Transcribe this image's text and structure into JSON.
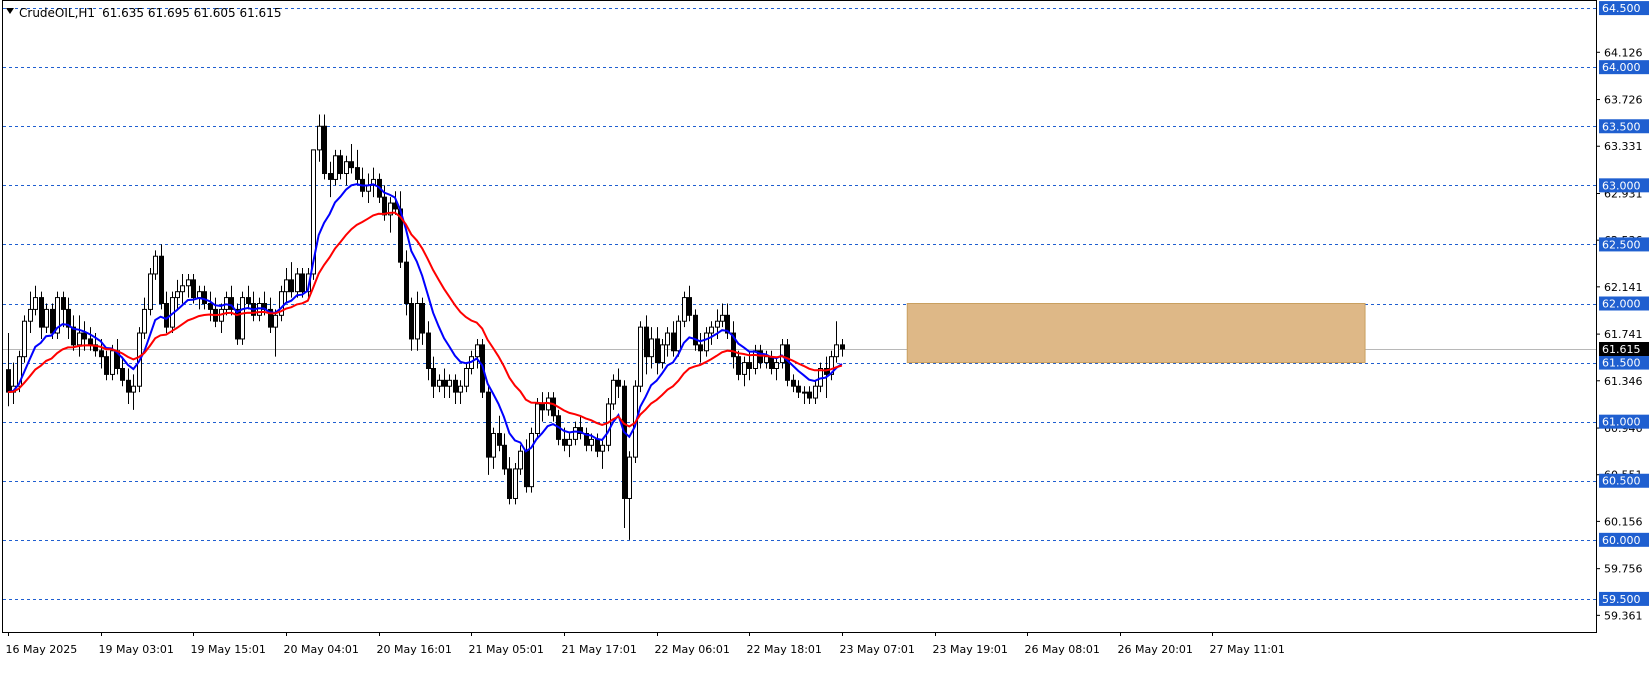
{
  "header": {
    "symbol_label": "CrudeOIL,H1",
    "ohlc_label": "61.635 61.695 61.605 61.615"
  },
  "colors": {
    "background": "#ffffff",
    "frame": "#000000",
    "grid_dashed": "#1f5fd0",
    "price_box_fill": "#1f5fd0",
    "current_price_fill": "#000000",
    "ma_fast": "#0000ff",
    "ma_slow": "#ff0000",
    "zone_fill": "#deb887",
    "zone_stroke": "#c9a060",
    "candle_up_fill": "#ffffff",
    "candle_down_fill": "#000000",
    "candle_stroke": "#000000"
  },
  "chart_data": {
    "type": "candlestick",
    "symbol": "CrudeOIL",
    "timeframe": "H1",
    "ylim": [
      59.22,
      64.56
    ],
    "current_price": 61.615,
    "current_price_label": "61.615",
    "axis_ticks": [
      {
        "value": 64.126,
        "label": "64.126"
      },
      {
        "value": 63.726,
        "label": "63.726"
      },
      {
        "value": 63.331,
        "label": "63.331"
      },
      {
        "value": 62.931,
        "label": "62.931"
      },
      {
        "value": 62.536,
        "label": "62.536"
      },
      {
        "value": 62.141,
        "label": "62.141"
      },
      {
        "value": 61.741,
        "label": "61.741"
      },
      {
        "value": 61.346,
        "label": "61.346"
      },
      {
        "value": 60.946,
        "label": "60.946"
      },
      {
        "value": 60.551,
        "label": "60.551"
      },
      {
        "value": 60.156,
        "label": "60.156"
      },
      {
        "value": 59.756,
        "label": "59.756"
      },
      {
        "value": 59.361,
        "label": "59.361"
      }
    ],
    "levels": [
      {
        "value": 64.5,
        "label": "64.500"
      },
      {
        "value": 64.0,
        "label": "64.000"
      },
      {
        "value": 63.5,
        "label": "63.500"
      },
      {
        "value": 63.0,
        "label": "63.000"
      },
      {
        "value": 62.5,
        "label": "62.500"
      },
      {
        "value": 62.0,
        "label": "62.000"
      },
      {
        "value": 61.5,
        "label": "61.500"
      },
      {
        "value": 61.0,
        "label": "61.000"
      },
      {
        "value": 60.5,
        "label": "60.500"
      },
      {
        "value": 60.0,
        "label": "60.000"
      },
      {
        "value": 59.5,
        "label": "59.500"
      }
    ],
    "zone": {
      "from_bar": 165,
      "to_bar": 249,
      "low": 61.5,
      "high": 62.0
    },
    "x_labels": [
      {
        "bar": 0,
        "label": "16 May 2025"
      },
      {
        "bar": 17,
        "label": "19 May 03:01"
      },
      {
        "bar": 34,
        "label": "19 May 15:01"
      },
      {
        "bar": 51,
        "label": "20 May 04:01"
      },
      {
        "bar": 68,
        "label": "20 May 16:01"
      },
      {
        "bar": 85,
        "label": "21 May 05:01"
      },
      {
        "bar": 102,
        "label": "21 May 17:01"
      },
      {
        "bar": 119,
        "label": "22 May 06:01"
      },
      {
        "bar": 136,
        "label": "22 May 18:01"
      },
      {
        "bar": 153,
        "label": "23 May 07:01"
      },
      {
        "bar": 170,
        "label": "23 May 19:01"
      },
      {
        "bar": 187,
        "label": "26 May 08:01"
      },
      {
        "bar": 204,
        "label": "26 May 20:01"
      },
      {
        "bar": 221,
        "label": "27 May 11:01"
      }
    ],
    "ma_fast_period_color": "blue",
    "ma_slow_period_color": "red",
    "ohlc": [
      [
        61.44,
        61.75,
        61.13,
        61.25
      ],
      [
        61.25,
        61.5,
        61.15,
        61.3
      ],
      [
        61.3,
        61.6,
        61.25,
        61.55
      ],
      [
        61.55,
        61.9,
        61.5,
        61.85
      ],
      [
        61.85,
        62.1,
        61.75,
        61.95
      ],
      [
        61.95,
        62.15,
        61.9,
        62.05
      ],
      [
        62.05,
        62.1,
        61.7,
        61.8
      ],
      [
        61.8,
        62.0,
        61.75,
        61.95
      ],
      [
        61.95,
        62.0,
        61.7,
        61.75
      ],
      [
        61.75,
        62.1,
        61.7,
        62.05
      ],
      [
        62.05,
        62.1,
        61.8,
        61.95
      ],
      [
        61.95,
        62.05,
        61.7,
        61.8
      ],
      [
        61.8,
        61.9,
        61.6,
        61.65
      ],
      [
        61.65,
        61.9,
        61.55,
        61.75
      ],
      [
        61.75,
        61.85,
        61.6,
        61.7
      ],
      [
        61.7,
        61.8,
        61.6,
        61.65
      ],
      [
        61.65,
        61.75,
        61.55,
        61.6
      ],
      [
        61.6,
        61.7,
        61.45,
        61.55
      ],
      [
        61.55,
        61.6,
        61.35,
        61.4
      ],
      [
        61.4,
        61.65,
        61.35,
        61.6
      ],
      [
        61.6,
        61.7,
        61.4,
        61.45
      ],
      [
        61.45,
        61.55,
        61.3,
        61.35
      ],
      [
        61.35,
        61.45,
        61.15,
        61.25
      ],
      [
        61.25,
        61.4,
        61.1,
        61.3
      ],
      [
        61.3,
        61.8,
        61.25,
        61.75
      ],
      [
        61.75,
        62.05,
        61.7,
        61.95
      ],
      [
        61.95,
        62.3,
        61.9,
        62.25
      ],
      [
        62.25,
        62.45,
        62.2,
        62.4
      ],
      [
        62.4,
        62.5,
        61.95,
        62.0
      ],
      [
        62.0,
        62.1,
        61.75,
        61.8
      ],
      [
        61.8,
        62.1,
        61.75,
        62.05
      ],
      [
        62.05,
        62.2,
        61.95,
        62.1
      ],
      [
        62.1,
        62.25,
        62.0,
        62.15
      ],
      [
        62.15,
        62.25,
        62.05,
        62.2
      ],
      [
        62.2,
        62.25,
        62.0,
        62.05
      ],
      [
        62.05,
        62.15,
        61.95,
        62.1
      ],
      [
        62.1,
        62.15,
        61.95,
        62.0
      ],
      [
        62.0,
        62.1,
        61.85,
        61.95
      ],
      [
        61.95,
        62.05,
        61.8,
        61.85
      ],
      [
        61.85,
        62.0,
        61.75,
        61.95
      ],
      [
        61.95,
        62.1,
        61.9,
        62.05
      ],
      [
        62.05,
        62.15,
        61.9,
        61.95
      ],
      [
        61.95,
        62.0,
        61.65,
        61.7
      ],
      [
        61.7,
        62.1,
        61.65,
        62.05
      ],
      [
        62.05,
        62.15,
        61.95,
        62.0
      ],
      [
        62.0,
        62.1,
        61.85,
        61.9
      ],
      [
        61.9,
        62.05,
        61.85,
        62.0
      ],
      [
        62.0,
        62.1,
        61.9,
        61.95
      ],
      [
        61.95,
        62.05,
        61.75,
        61.8
      ],
      [
        61.8,
        61.95,
        61.55,
        61.9
      ],
      [
        61.9,
        62.15,
        61.85,
        62.1
      ],
      [
        62.1,
        62.3,
        62.0,
        62.2
      ],
      [
        62.2,
        62.35,
        62.05,
        62.1
      ],
      [
        62.1,
        62.3,
        62.05,
        62.25
      ],
      [
        62.25,
        62.3,
        62.05,
        62.1
      ],
      [
        62.1,
        62.3,
        62.05,
        62.25
      ],
      [
        62.25,
        63.3,
        62.2,
        63.3
      ],
      [
        63.3,
        63.6,
        63.2,
        63.5
      ],
      [
        63.5,
        63.6,
        63.05,
        63.1
      ],
      [
        63.1,
        63.2,
        62.9,
        63.05
      ],
      [
        63.05,
        63.3,
        63.0,
        63.25
      ],
      [
        63.25,
        63.3,
        63.05,
        63.1
      ],
      [
        63.1,
        63.25,
        63.0,
        63.2
      ],
      [
        63.2,
        63.35,
        63.1,
        63.15
      ],
      [
        63.15,
        63.3,
        63.0,
        63.05
      ],
      [
        63.05,
        63.15,
        62.9,
        62.95
      ],
      [
        62.95,
        63.1,
        62.85,
        63.0
      ],
      [
        63.0,
        63.15,
        62.9,
        63.05
      ],
      [
        63.05,
        63.1,
        62.85,
        62.9
      ],
      [
        62.9,
        63.0,
        62.7,
        62.75
      ],
      [
        62.75,
        62.9,
        62.6,
        62.85
      ],
      [
        62.85,
        62.95,
        62.75,
        62.8
      ],
      [
        62.8,
        62.95,
        62.3,
        62.35
      ],
      [
        62.35,
        62.45,
        61.9,
        62.0
      ],
      [
        62.0,
        62.05,
        61.6,
        61.7
      ],
      [
        61.7,
        62.1,
        61.6,
        62.0
      ],
      [
        62.0,
        62.05,
        61.65,
        61.75
      ],
      [
        61.75,
        61.85,
        61.35,
        61.45
      ],
      [
        61.45,
        61.55,
        61.2,
        61.3
      ],
      [
        61.3,
        61.4,
        61.25,
        61.35
      ],
      [
        61.35,
        61.45,
        61.2,
        61.3
      ],
      [
        61.3,
        61.4,
        61.2,
        61.35
      ],
      [
        61.35,
        61.4,
        61.15,
        61.25
      ],
      [
        61.25,
        61.35,
        61.15,
        61.3
      ],
      [
        61.3,
        61.5,
        61.25,
        61.45
      ],
      [
        61.45,
        61.6,
        61.4,
        61.55
      ],
      [
        61.55,
        61.7,
        61.45,
        61.65
      ],
      [
        61.65,
        61.7,
        61.2,
        61.25
      ],
      [
        61.25,
        61.3,
        60.55,
        60.7
      ],
      [
        60.7,
        60.95,
        60.6,
        60.9
      ],
      [
        60.9,
        61.05,
        60.75,
        60.8
      ],
      [
        60.8,
        60.9,
        60.55,
        60.6
      ],
      [
        60.6,
        60.7,
        60.3,
        60.35
      ],
      [
        60.35,
        60.65,
        60.3,
        60.6
      ],
      [
        60.6,
        60.8,
        60.55,
        60.75
      ],
      [
        60.75,
        60.85,
        60.4,
        60.45
      ],
      [
        60.45,
        60.95,
        60.4,
        60.9
      ],
      [
        60.9,
        61.2,
        60.85,
        61.15
      ],
      [
        61.15,
        61.25,
        61.0,
        61.1
      ],
      [
        61.1,
        61.25,
        61.05,
        61.2
      ],
      [
        61.2,
        61.25,
        61.0,
        61.05
      ],
      [
        61.05,
        61.1,
        60.8,
        60.85
      ],
      [
        60.85,
        60.95,
        60.75,
        60.8
      ],
      [
        60.8,
        60.9,
        60.7,
        60.85
      ],
      [
        60.85,
        61.0,
        60.8,
        60.95
      ],
      [
        60.95,
        61.05,
        60.85,
        60.9
      ],
      [
        60.9,
        60.95,
        60.75,
        60.8
      ],
      [
        60.8,
        60.9,
        60.75,
        60.85
      ],
      [
        60.85,
        60.9,
        60.7,
        60.75
      ],
      [
        60.75,
        60.85,
        60.6,
        60.8
      ],
      [
        60.8,
        61.2,
        60.75,
        61.15
      ],
      [
        61.15,
        61.4,
        61.1,
        61.35
      ],
      [
        61.35,
        61.45,
        61.2,
        61.3
      ],
      [
        61.3,
        61.35,
        60.1,
        60.35
      ],
      [
        60.35,
        60.75,
        60.0,
        60.7
      ],
      [
        60.7,
        61.35,
        60.65,
        61.3
      ],
      [
        61.3,
        61.85,
        61.25,
        61.8
      ],
      [
        61.8,
        61.9,
        61.4,
        61.55
      ],
      [
        61.55,
        61.8,
        61.45,
        61.7
      ],
      [
        61.7,
        61.8,
        61.4,
        61.5
      ],
      [
        61.5,
        61.7,
        61.45,
        61.65
      ],
      [
        61.65,
        61.8,
        61.55,
        61.75
      ],
      [
        61.75,
        61.85,
        61.55,
        61.6
      ],
      [
        61.6,
        61.9,
        61.55,
        61.85
      ],
      [
        61.85,
        62.1,
        61.8,
        62.05
      ],
      [
        62.05,
        62.15,
        61.85,
        61.9
      ],
      [
        61.9,
        61.95,
        61.6,
        61.65
      ],
      [
        61.65,
        61.75,
        61.5,
        61.6
      ],
      [
        61.6,
        61.8,
        61.55,
        61.75
      ],
      [
        61.75,
        61.85,
        61.65,
        61.8
      ],
      [
        61.8,
        61.95,
        61.7,
        61.85
      ],
      [
        61.85,
        62.0,
        61.8,
        61.9
      ],
      [
        61.9,
        62.0,
        61.7,
        61.75
      ],
      [
        61.75,
        61.85,
        61.45,
        61.55
      ],
      [
        61.55,
        61.6,
        61.35,
        61.4
      ],
      [
        61.4,
        61.55,
        61.3,
        61.5
      ],
      [
        61.5,
        61.6,
        61.35,
        61.45
      ],
      [
        61.45,
        61.65,
        61.4,
        61.6
      ],
      [
        61.6,
        61.65,
        61.45,
        61.5
      ],
      [
        61.5,
        61.6,
        61.45,
        61.55
      ],
      [
        61.55,
        61.6,
        61.4,
        61.45
      ],
      [
        61.45,
        61.55,
        61.35,
        61.5
      ],
      [
        61.5,
        61.7,
        61.45,
        61.65
      ],
      [
        61.65,
        61.7,
        61.3,
        61.35
      ],
      [
        61.35,
        61.4,
        61.25,
        61.3
      ],
      [
        61.3,
        61.35,
        61.2,
        61.25
      ],
      [
        61.25,
        61.3,
        61.15,
        61.25
      ],
      [
        61.25,
        61.3,
        61.15,
        61.2
      ],
      [
        61.2,
        61.35,
        61.15,
        61.3
      ],
      [
        61.3,
        61.5,
        61.25,
        61.45
      ],
      [
        61.45,
        61.55,
        61.2,
        61.4
      ],
      [
        61.4,
        61.6,
        61.35,
        61.55
      ],
      [
        61.55,
        61.85,
        61.5,
        61.65
      ],
      [
        61.65,
        61.7,
        61.55,
        61.615
      ]
    ]
  }
}
